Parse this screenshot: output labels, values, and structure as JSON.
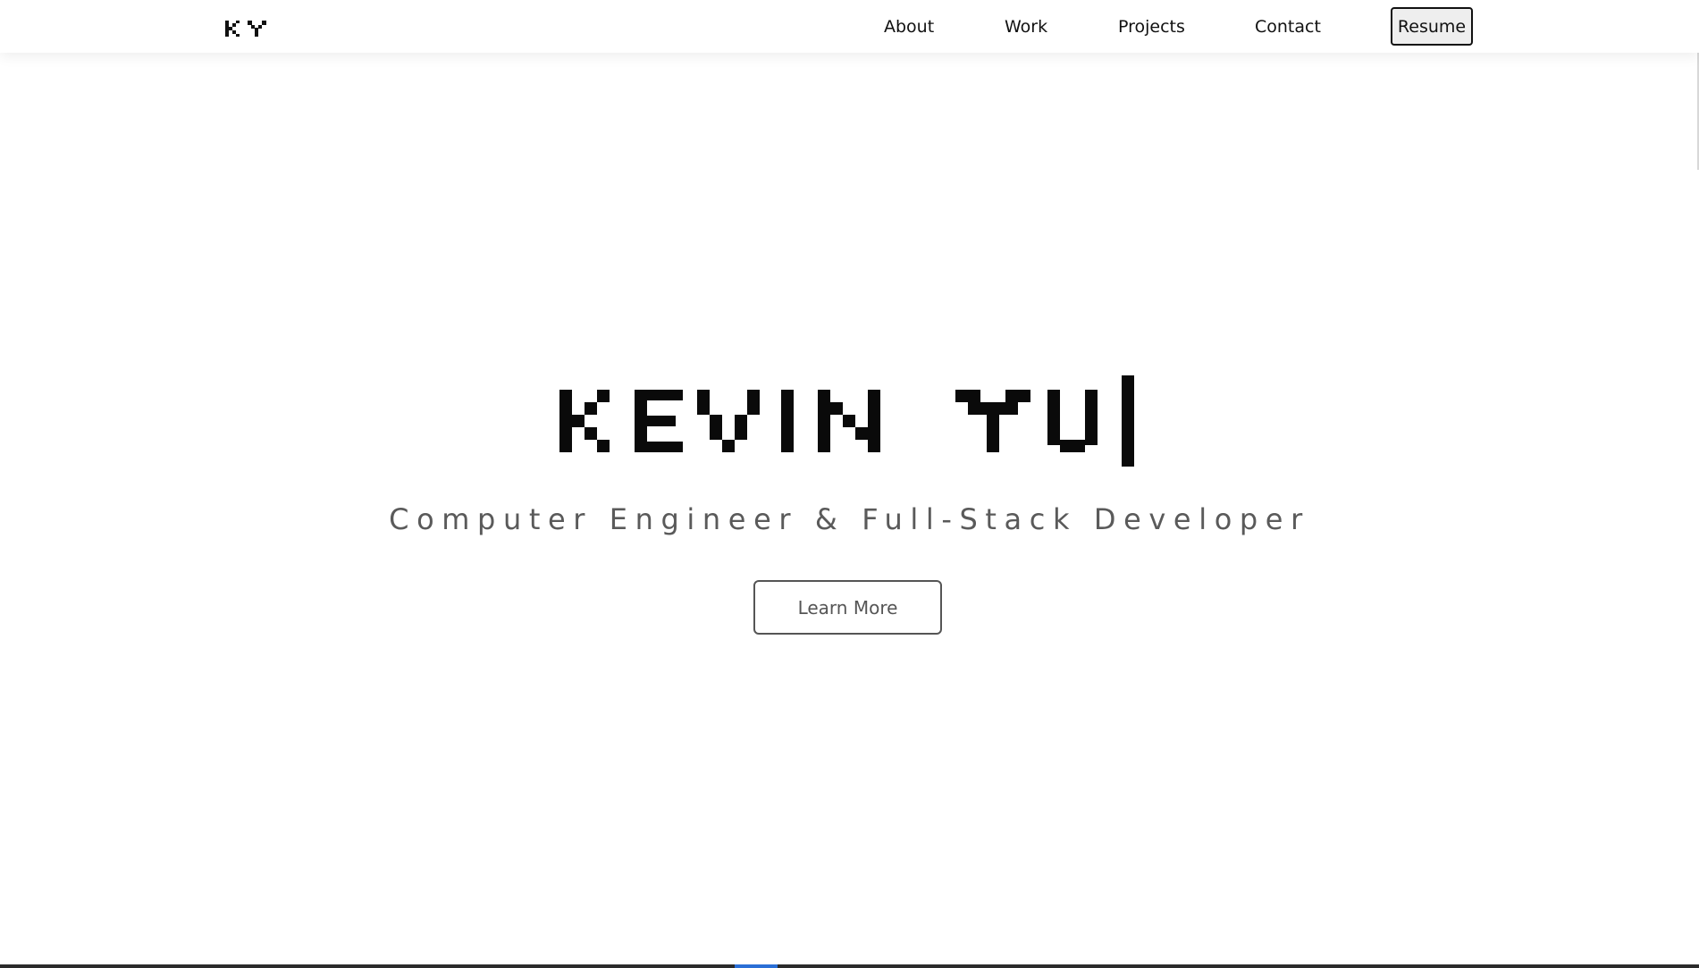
{
  "brand": {
    "logo_text": "KY"
  },
  "nav": {
    "items": [
      {
        "label": "About"
      },
      {
        "label": "Work"
      },
      {
        "label": "Projects"
      },
      {
        "label": "Contact"
      }
    ],
    "resume_label": "Resume"
  },
  "hero": {
    "title": "KEVIN YU",
    "subtitle": "Computer Engineer & Full-Stack Developer",
    "cta_label": "Learn More"
  },
  "colors": {
    "text_primary": "#111111",
    "text_secondary": "#5a5a5a",
    "background": "#ffffff",
    "resume_button_bg": "#eeeeee",
    "accent": "#2a6fd6"
  }
}
